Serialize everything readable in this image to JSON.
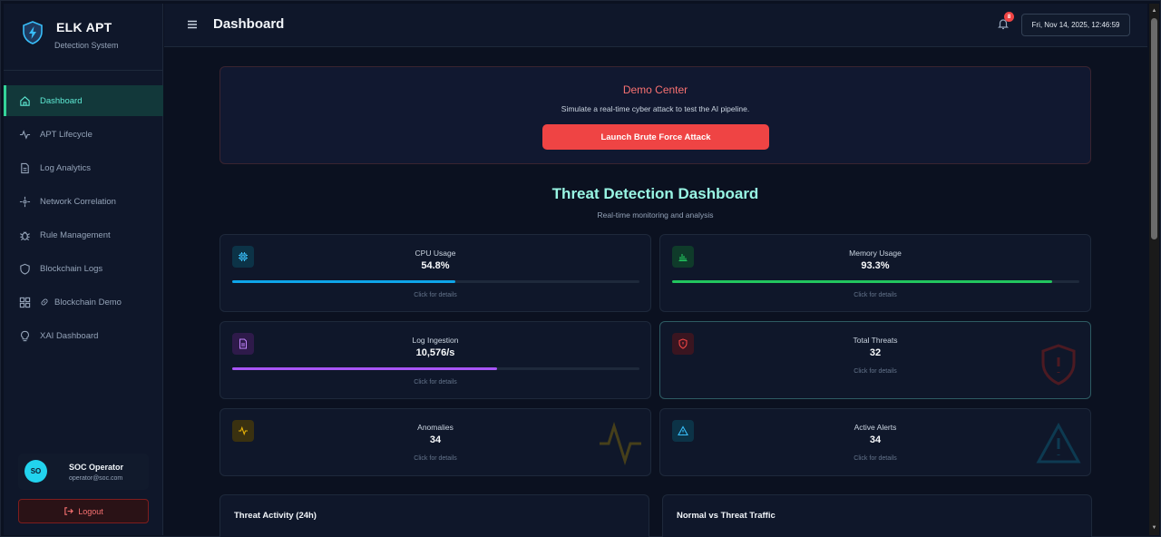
{
  "brand": {
    "title": "ELK APT",
    "subtitle": "Detection System"
  },
  "nav": [
    {
      "label": "Dashboard",
      "icon": "home-icon",
      "active": true
    },
    {
      "label": "APT Lifecycle",
      "icon": "activity-icon"
    },
    {
      "label": "Log Analytics",
      "icon": "file-icon"
    },
    {
      "label": "Network Correlation",
      "icon": "network-icon"
    },
    {
      "label": "Rule Management",
      "icon": "bug-icon"
    },
    {
      "label": "Blockchain Logs",
      "icon": "shield-icon"
    },
    {
      "label": "Blockchain Demo",
      "icon": "grid-icon",
      "extra_icon": "link-icon"
    },
    {
      "label": "XAI Dashboard",
      "icon": "lightbulb-icon"
    }
  ],
  "user": {
    "initials": "SO",
    "name": "SOC Operator",
    "email": "operator@soc.com"
  },
  "logout_label": "Logout",
  "header": {
    "title": "Dashboard",
    "notification_count": "8",
    "datetime": "Fri, Nov 14, 2025, 12:46:59"
  },
  "demo": {
    "title": "Demo Center",
    "description": "Simulate a real-time cyber attack to test the AI pipeline.",
    "button": "Launch Brute Force Attack"
  },
  "dashboard": {
    "title": "Threat Detection Dashboard",
    "subtitle": "Real-time monitoring and analysis"
  },
  "cards": {
    "cpu": {
      "label": "CPU Usage",
      "value": "54.8%",
      "progress": 0.548,
      "hint": "Click for details",
      "color": "#0ea5e9"
    },
    "memory": {
      "label": "Memory Usage",
      "value": "93.3%",
      "progress": 0.933,
      "hint": "Click for details",
      "color": "#22c55e"
    },
    "log": {
      "label": "Log Ingestion",
      "value": "10,576/s",
      "progress": 0.65,
      "hint": "Click for details",
      "color": "#a855f7"
    },
    "threats": {
      "label": "Total Threats",
      "value": "32",
      "hint": "Click for details",
      "color": "#ef4444"
    },
    "anomalies": {
      "label": "Anomalies",
      "value": "34",
      "hint": "Click for details",
      "color": "#eab308"
    },
    "alerts": {
      "label": "Active Alerts",
      "value": "34",
      "hint": "Click for details",
      "color": "#0ea5e9"
    }
  },
  "charts": {
    "activity_title": "Threat Activity (24h)",
    "traffic_title": "Normal vs Threat Traffic"
  },
  "colors": {
    "accent": "#34d399",
    "danger": "#ef4444",
    "background": "#0b1120"
  }
}
